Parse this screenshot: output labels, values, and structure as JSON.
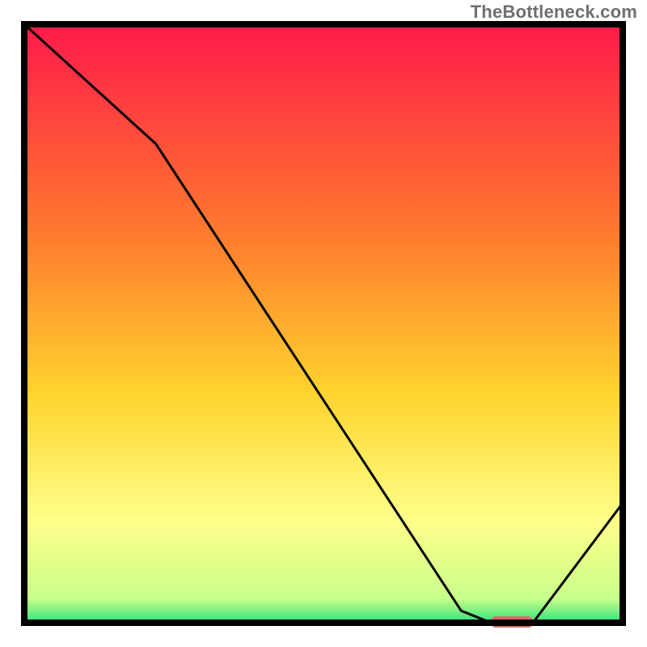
{
  "attribution": "TheBottleneck.com",
  "colors": {
    "frame": "#000000",
    "curve": "#000000",
    "marker": "#d86b6b",
    "grad_top": "#ff1a4a",
    "grad_mid1": "#ff7a2e",
    "grad_mid2": "#ffd52e",
    "grad_low": "#ffff8a",
    "grad_green": "#2fe37a"
  },
  "chart_data": {
    "type": "line",
    "title": "",
    "xlabel": "",
    "ylabel": "",
    "xlim": [
      0,
      100
    ],
    "ylim": [
      0,
      100
    ],
    "x": [
      0,
      22,
      73,
      78,
      85,
      100
    ],
    "values": [
      100,
      80,
      2,
      0,
      0,
      20
    ],
    "marker": {
      "x_start": 78,
      "x_end": 85,
      "y": 0
    },
    "annotations": []
  }
}
